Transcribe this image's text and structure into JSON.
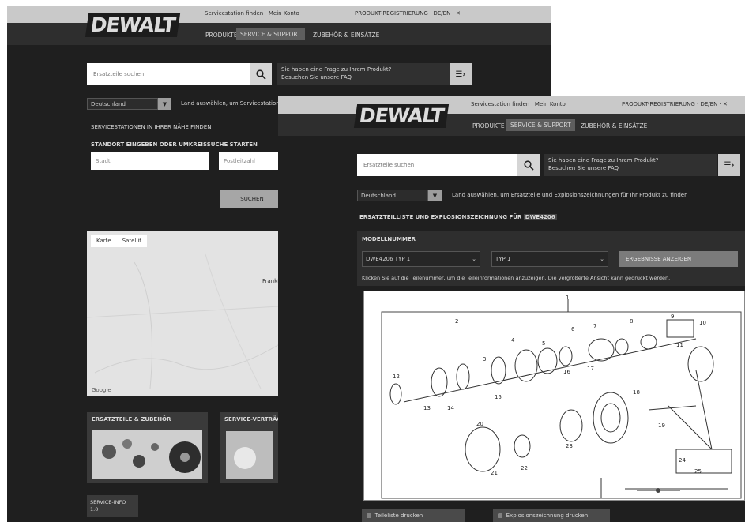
{
  "back_window": {
    "header": {
      "brand": "DEWALT",
      "top_text": "Servicestation finden · Mein Konto",
      "top_right": "PRODUKT-REGISTRIERUNG · DE/EN · ✕",
      "nav": [
        "PRODUKTE",
        "SERVICE & SUPPORT",
        "ZUBEHÖR & EINSÄTZE"
      ],
      "active_nav": "SERVICE & SUPPORT"
    },
    "search": {
      "placeholder": "Ersatzteile suchen"
    },
    "promo": {
      "line1": "Sie haben eine Frage zu Ihrem Produkt?",
      "line2": "Besuchen Sie unsere FAQ"
    },
    "country_dd": "Deutschland",
    "country_note": "Land auswählen, um Servicestationen in Ihrer Nähe zu finden",
    "heading_service": "SERVICESTATIONEN IN IHRER NÄHE FINDEN",
    "heading_location": "STANDORT EINGEBEN ODER UMKREISSUCHE STARTEN",
    "input_city": "Stadt",
    "input_zip": "Postleitzahl",
    "search_button": "SUCHEN",
    "map_tabs": [
      "Karte",
      "Satellit"
    ],
    "map_footer": "Google",
    "map_label": "Frankfurt",
    "card1_title": "ERSATZTEILE & ZUBEHÖR",
    "card2_title": "SERVICE-VERTRÄGE",
    "small_card": "SERVICE-INFO 1.0"
  },
  "front_window": {
    "header": {
      "brand": "DEWALT",
      "top_text": "Servicestation finden · Mein Konto",
      "top_right": "PRODUKT-REGISTRIERUNG · DE/EN · ✕",
      "nav": [
        "PRODUKTE",
        "SERVICE & SUPPORT",
        "ZUBEHÖR & EINSÄTZE"
      ],
      "active_nav": "SERVICE & SUPPORT"
    },
    "search": {
      "placeholder": "Ersatzteile suchen"
    },
    "promo": {
      "line1": "Sie haben eine Frage zu Ihrem Produkt?",
      "line2": "Besuchen Sie unsere FAQ"
    },
    "country_dd": "Deutschland",
    "country_note": "Land auswählen, um Ersatzteile und Explosionszeichnungen für Ihr Produkt zu finden",
    "breadcrumb": "ERSATZTEILLISTE UND EXPLOSIONSZEICHNUNG FÜR",
    "breadcrumb_highlight": "DWE4206",
    "section_label": "MODELLNUMMER",
    "dd_model": "DWE4206 TYP 1",
    "dd_type": "TYP 1",
    "show_button": "ERGEBNISSE ANZEIGEN",
    "diagram_note": "Klicken Sie auf die Teilenummer, um die Teileinformationen anzuzeigen. Die vergrößerte Ansicht kann gedruckt werden.",
    "callouts": [
      "1",
      "2",
      "3",
      "4",
      "5",
      "6",
      "7",
      "8",
      "9",
      "10",
      "11",
      "12",
      "13",
      "14",
      "15",
      "16",
      "17",
      "18",
      "19",
      "20",
      "21",
      "22",
      "23",
      "24",
      "25"
    ],
    "bottom_btn1": "Teileliste drucken",
    "bottom_btn2": "Explosionszeichnung drucken"
  }
}
